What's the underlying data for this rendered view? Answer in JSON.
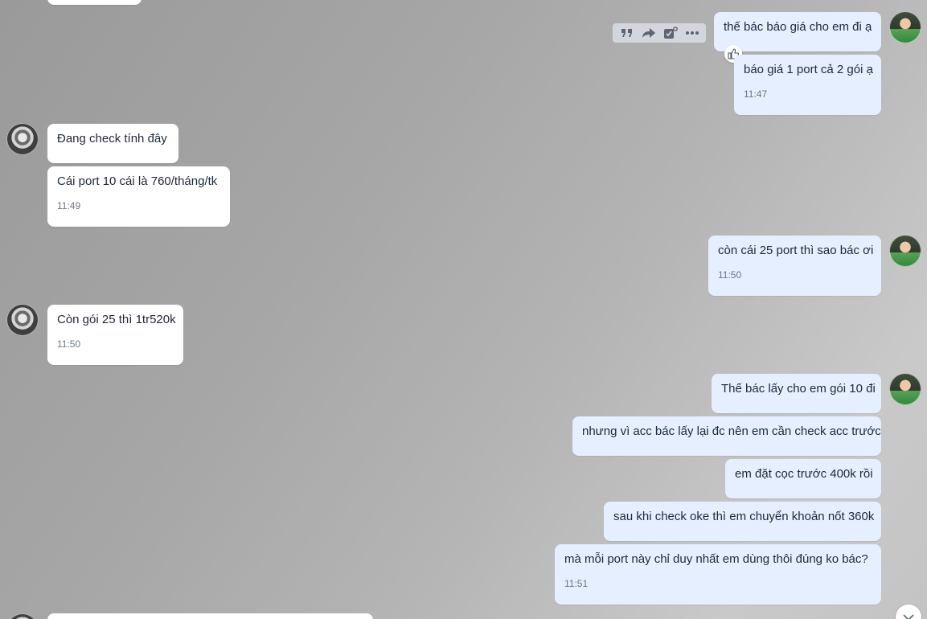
{
  "messages": [
    {
      "text": "thế bác báo giá cho em đi ạ"
    },
    {
      "text": "báo giá 1 port cả 2 gói ạ",
      "time": "11:47"
    },
    {
      "text": "Đang check tính đây"
    },
    {
      "text": "Cái port 10 cái là 760/tháng/tk",
      "time": "11:49"
    },
    {
      "text": "còn cái 25 port thì sao bác ơi",
      "time": "11:50"
    },
    {
      "text": "Còn gói 25 thì 1tr520k",
      "time": "11:50"
    },
    {
      "text": "Thế bác lấy cho em gói 10 đi"
    },
    {
      "text": "nhưng vì acc bác lấy lại đc nên em cần check acc trước"
    },
    {
      "text": "em đặt cọc trước 400k rồi"
    },
    {
      "text": "sau khi check oke thì em chuyển khoản nốt 360k"
    },
    {
      "text": "mà mỗi port này chỉ duy nhất em dùng thôi đúng ko bác?",
      "time": "11:51"
    }
  ],
  "toolbar": {
    "icons": [
      "quote-icon",
      "forward-icon",
      "task-icon",
      "more-icon"
    ]
  },
  "colors": {
    "incoming_bubble": "#ffffff",
    "outgoing_bubble": "#e5efff",
    "text": "#1c2a3a",
    "time": "#6b7785"
  }
}
